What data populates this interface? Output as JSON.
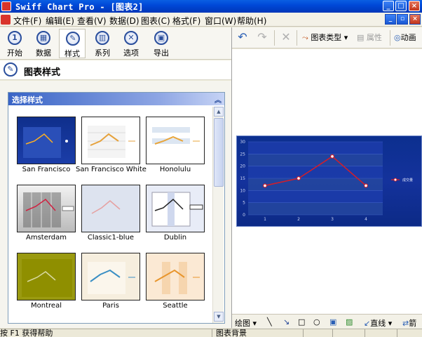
{
  "window": {
    "title": "Swiff Chart Pro - [图表2]"
  },
  "menu": [
    "文件(F)",
    "编辑(E)",
    "查看(V)",
    "数据(D)",
    "图表(C)",
    "格式(F)",
    "窗口(W)",
    "帮助(H)"
  ],
  "toolbar": {
    "items": [
      {
        "label": "开始",
        "icon": "start-icon"
      },
      {
        "label": "数据",
        "icon": "data-icon"
      },
      {
        "label": "样式",
        "icon": "style-icon",
        "active": true
      },
      {
        "label": "系列",
        "icon": "series-icon"
      },
      {
        "label": "选项",
        "icon": "options-icon"
      },
      {
        "label": "导出",
        "icon": "export-icon"
      }
    ]
  },
  "section": {
    "title": "图表样式"
  },
  "panel": {
    "title": "选择样式",
    "styles": [
      "San Francisco",
      "San Francisco White",
      "Honolulu",
      "Amsterdam",
      "Classic1-blue",
      "Dublin",
      "Montreal",
      "Paris",
      "Seattle"
    ]
  },
  "right_toolbar": {
    "chart_type": "图表类型",
    "properties": "属性",
    "animation": "动画"
  },
  "bottom_toolbar": {
    "draw": "绘图",
    "line": "直线",
    "arrow": "箭"
  },
  "status": {
    "help": "按 F1 获得帮助",
    "selection": "图表背景"
  },
  "chart_data": {
    "type": "line",
    "x": [
      1,
      2,
      3,
      4
    ],
    "series": [
      {
        "name": "成交量",
        "values": [
          12,
          15,
          24,
          12
        ]
      }
    ],
    "ylim": [
      0,
      30
    ],
    "yticks": [
      0,
      5,
      10,
      15,
      20,
      25,
      30
    ],
    "colors": {
      "background": "#14329c",
      "line": "#cc1f2e"
    }
  }
}
